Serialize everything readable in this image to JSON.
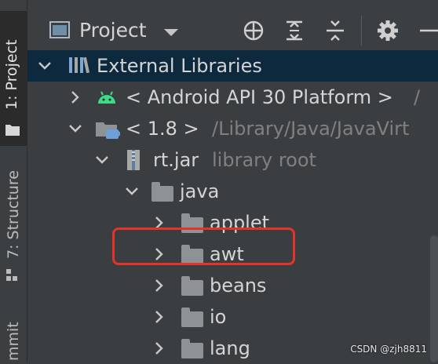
{
  "tool_window": {
    "project_tab": "1: Project",
    "structure_tab": "7: Structure",
    "commit_tab": "mmit"
  },
  "header": {
    "title": "Project"
  },
  "tree": {
    "external_libraries": "External Libraries",
    "android_sdk": "< Android API 30 Platform >",
    "android_sdk_path": "/",
    "jdk": "< 1.8 >",
    "jdk_path": "/Library/Java/JavaVirt",
    "jar": "rt.jar",
    "jar_hint": "library root",
    "pkg_java": "java",
    "pkg_applet": "applet",
    "pkg_awt": "awt",
    "pkg_beans": "beans",
    "pkg_io": "io",
    "pkg_lang": "lang"
  },
  "watermark": "CSDN @zjh8811",
  "colors": {
    "highlight": "#e5332a",
    "android": "#3ddc84",
    "jdk_blue": "#6f9ed8"
  }
}
